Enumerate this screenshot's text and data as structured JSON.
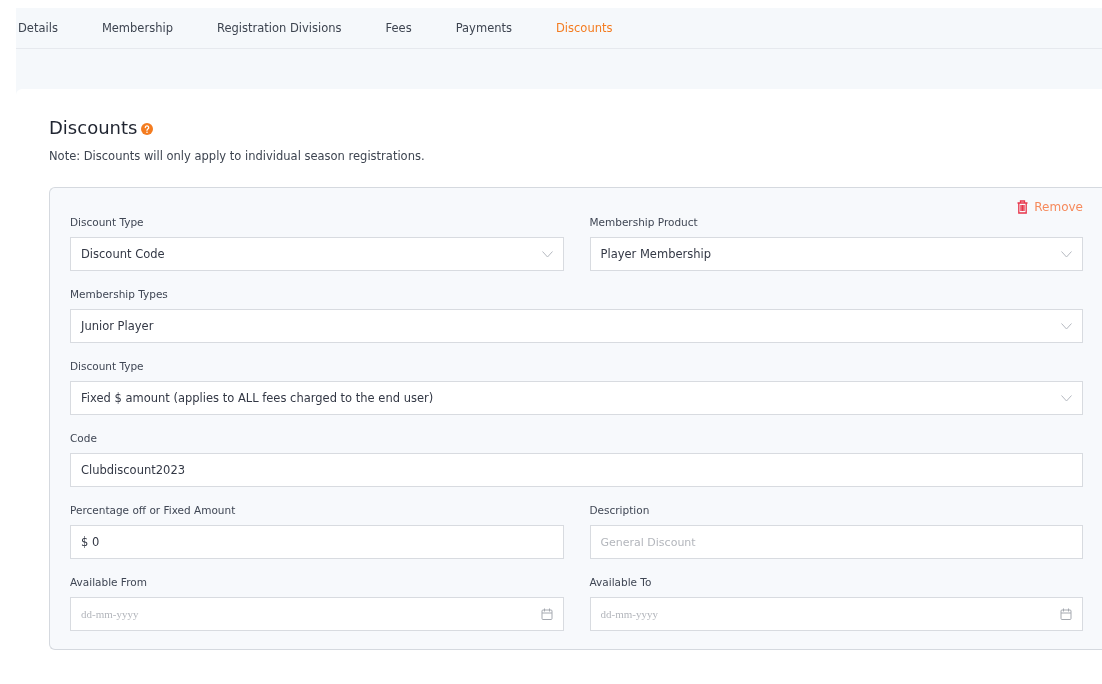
{
  "tabs": [
    {
      "label": "Details",
      "selected": false
    },
    {
      "label": "Membership",
      "selected": false
    },
    {
      "label": "Registration Divisions",
      "selected": false
    },
    {
      "label": "Fees",
      "selected": false
    },
    {
      "label": "Payments",
      "selected": false
    },
    {
      "label": "Discounts",
      "selected": true
    }
  ],
  "section": {
    "title": "Discounts",
    "note": "Note: Discounts will only apply to individual season registrations."
  },
  "panel": {
    "remove_button": "Remove",
    "rows": [
      [
        {
          "label": "Discount Type",
          "kind": "select",
          "value": "Discount Code"
        },
        {
          "label": "Membership Product",
          "kind": "select",
          "value": "Player Membership"
        }
      ],
      [
        {
          "label": "Membership Types",
          "kind": "select",
          "value": "Junior Player"
        }
      ],
      [
        {
          "label": "Discount Type",
          "kind": "select",
          "value": "Fixed $ amount (applies to ALL fees charged to the end user)"
        }
      ],
      [
        {
          "label": "Code",
          "kind": "text",
          "value": "Clubdiscount2023"
        }
      ],
      [
        {
          "label": "Percentage off or Fixed Amount",
          "kind": "text",
          "value": "$ 0"
        },
        {
          "label": "Description",
          "kind": "text",
          "placeholder": "General Discount"
        }
      ],
      [
        {
          "label": "Available From",
          "kind": "date",
          "placeholder": "dd-mm-yyyy"
        },
        {
          "label": "Available To",
          "kind": "date",
          "placeholder": "dd-mm-yyyy"
        }
      ]
    ]
  }
}
